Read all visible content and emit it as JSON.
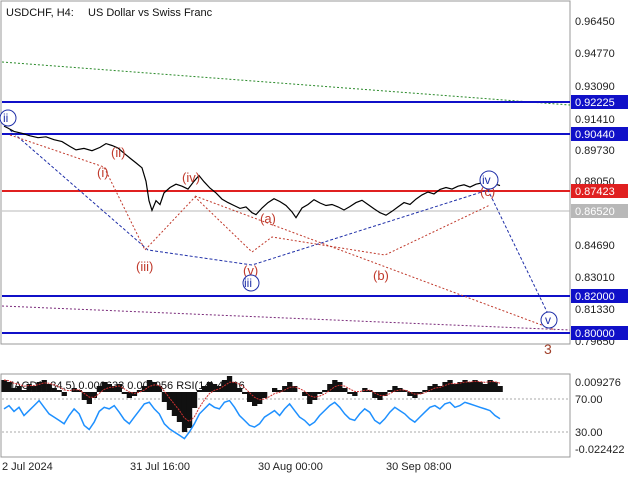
{
  "header": {
    "instrument": "USDCHF, H4:",
    "description": "US Dollar vs Swiss Franc"
  },
  "chart_data": [
    {
      "type": "line",
      "series": [
        {
          "values": [
            [
              0,
              0.9045
            ],
            [
              4,
              0.9035
            ],
            [
              10,
              0.9018
            ],
            [
              18,
              0.9008
            ],
            [
              26,
              0.8995
            ],
            [
              34,
              0.8985
            ],
            [
              42,
              0.899
            ],
            [
              50,
              0.8975
            ],
            [
              58,
              0.8965
            ],
            [
              66,
              0.894
            ],
            [
              72,
              0.8922
            ],
            [
              80,
              0.893
            ],
            [
              88,
              0.8918
            ],
            [
              96,
              0.8935
            ],
            [
              102,
              0.8955
            ],
            [
              108,
              0.8945
            ],
            [
              114,
              0.8932
            ],
            [
              120,
              0.8905
            ],
            [
              126,
              0.888
            ],
            [
              132,
              0.8855
            ],
            [
              138,
              0.883
            ],
            [
              142,
              0.876
            ],
            [
              145,
              0.866
            ],
            [
              148,
              0.861
            ],
            [
              152,
              0.866
            ],
            [
              156,
              0.864
            ],
            [
              160,
              0.87
            ],
            [
              166,
              0.8728
            ],
            [
              172,
              0.8745
            ],
            [
              178,
              0.8735
            ],
            [
              184,
              0.872
            ],
            [
              190,
              0.876
            ],
            [
              195,
              0.879
            ],
            [
              200,
              0.8758
            ],
            [
              206,
              0.8725
            ],
            [
              212,
              0.87
            ],
            [
              218,
              0.8668
            ],
            [
              224,
              0.865
            ],
            [
              230,
              0.8635
            ],
            [
              236,
              0.862
            ],
            [
              242,
              0.8628
            ],
            [
              248,
              0.8598
            ],
            [
              252,
              0.8588
            ],
            [
              258,
              0.8622
            ],
            [
              264,
              0.865
            ],
            [
              270,
              0.867
            ],
            [
              276,
              0.8655
            ],
            [
              282,
              0.8635
            ],
            [
              288,
              0.8602
            ],
            [
              292,
              0.8572
            ],
            [
              298,
              0.8622
            ],
            [
              304,
              0.864
            ],
            [
              310,
              0.8665
            ],
            [
              316,
              0.8648
            ],
            [
              322,
              0.8635
            ],
            [
              328,
              0.864
            ],
            [
              334,
              0.8628
            ],
            [
              340,
              0.8612
            ],
            [
              346,
              0.863
            ],
            [
              352,
              0.865
            ],
            [
              358,
              0.8662
            ],
            [
              364,
              0.864
            ],
            [
              370,
              0.8618
            ],
            [
              376,
              0.8598
            ],
            [
              382,
              0.8585
            ],
            [
              388,
              0.8605
            ],
            [
              394,
              0.8628
            ],
            [
              400,
              0.865
            ],
            [
              406,
              0.864
            ],
            [
              412,
              0.8668
            ],
            [
              418,
              0.869
            ],
            [
              424,
              0.8705
            ],
            [
              430,
              0.8695
            ],
            [
              436,
              0.8718
            ],
            [
              442,
              0.8728
            ],
            [
              448,
              0.872
            ],
            [
              454,
              0.8735
            ],
            [
              460,
              0.8742
            ],
            [
              466,
              0.873
            ],
            [
              472,
              0.8745
            ],
            [
              478,
              0.8752
            ],
            [
              484,
              0.8738
            ],
            [
              490,
              0.8748
            ],
            [
              496,
              0.8738
            ]
          ]
        }
      ],
      "x_ticks": [
        "2 Jul 2024",
        "31 Jul 16:00",
        "30 Aug 00:00",
        "30 Sep 08:00"
      ],
      "ylim": [
        0.7925,
        0.9686
      ],
      "y_ticks": [
        "0.96450",
        "0.94770",
        "0.93090",
        "0.91410",
        "0.89730",
        "0.88050",
        "0.84690",
        "0.83010",
        "0.81330",
        "0.79650"
      ],
      "levels": [
        {
          "value": "0.92225",
          "color": "#1010c8"
        },
        {
          "value": "0.90440",
          "color": "#1010c8"
        },
        {
          "value": "0.87423",
          "color": "#e02020"
        },
        {
          "value": "0.86520",
          "color": "#b8b8b8"
        },
        {
          "value": "0.82000",
          "color": "#1010c8"
        },
        {
          "value": "0.80000",
          "color": "#1010c8"
        }
      ],
      "wave_labels_red": [
        "(i)",
        "(ii)",
        "(iii)",
        "(iv)",
        "(v)",
        "(a)",
        "(b)",
        "(c)"
      ],
      "wave_labels_blue": [
        "ii",
        "iii",
        "iv",
        "v"
      ],
      "wave_label_brown": "3",
      "colors": {
        "price": "#000000",
        "red_wave": "#c0392b",
        "blue_wave": "#1f2fa8",
        "trend_green": "#2a8a2a"
      }
    },
    {
      "type": "area",
      "title": "MACD(5,34,5) 0.000633 0.000956 RSI(14) 48.16",
      "y_ticks": [
        "0.009276",
        "70.00",
        "30.00",
        "-0.022422"
      ],
      "macd_values": [
        0.006,
        0.005,
        0.002,
        0.003,
        0.001,
        0.004,
        0.003,
        0.005,
        0.006,
        0.004,
        0.002,
        0.001,
        -0.002,
        0.0,
        0.002,
        0.001,
        -0.004,
        -0.006,
        -0.003,
        0.003,
        0.005,
        0.004,
        0.003,
        0.004,
        -0.001,
        -0.003,
        -0.002,
        0.001,
        0.003,
        0.006,
        0.005,
        0.003,
        -0.005,
        -0.009,
        -0.012,
        -0.015,
        -0.02,
        -0.018,
        -0.008,
        0.001,
        0.003,
        0.005,
        0.004,
        0.003,
        0.006,
        0.008,
        0.005,
        0.002,
        -0.001,
        -0.005,
        -0.007,
        -0.006,
        -0.003,
        0.0,
        0.002,
        0.001,
        0.003,
        0.005,
        0.003,
        0.0,
        -0.002,
        -0.006,
        -0.004,
        -0.001,
        0.001,
        0.004,
        0.006,
        0.005,
        0.002,
        -0.001,
        -0.002,
        0.0,
        0.002,
        0.001,
        -0.003,
        -0.004,
        -0.002,
        0.001,
        0.003,
        0.002,
        0.001,
        -0.002,
        -0.003,
        -0.001,
        0.001,
        0.003,
        0.004,
        0.003,
        0.005,
        0.006,
        0.004,
        0.005,
        0.006,
        0.005,
        0.006,
        0.005,
        0.004,
        0.006,
        0.005,
        0.003
      ],
      "rsi_values": [
        58,
        62,
        55,
        60,
        50,
        56,
        62,
        68,
        60,
        52,
        48,
        44,
        40,
        50,
        58,
        52,
        38,
        33,
        42,
        55,
        60,
        58,
        62,
        54,
        45,
        40,
        48,
        56,
        64,
        66,
        58,
        52,
        40,
        34,
        30,
        26,
        22,
        30,
        40,
        52,
        58,
        64,
        60,
        58,
        66,
        68,
        60,
        50,
        44,
        38,
        36,
        40,
        48,
        52,
        56,
        50,
        58,
        64,
        56,
        48,
        44,
        38,
        42,
        50,
        56,
        62,
        66,
        60,
        52,
        46,
        44,
        52,
        58,
        54,
        44,
        40,
        46,
        54,
        60,
        56,
        52,
        46,
        42,
        48,
        54,
        60,
        62,
        58,
        64,
        66,
        60,
        62,
        66,
        64,
        62,
        60,
        58,
        56,
        50,
        46
      ]
    }
  ]
}
